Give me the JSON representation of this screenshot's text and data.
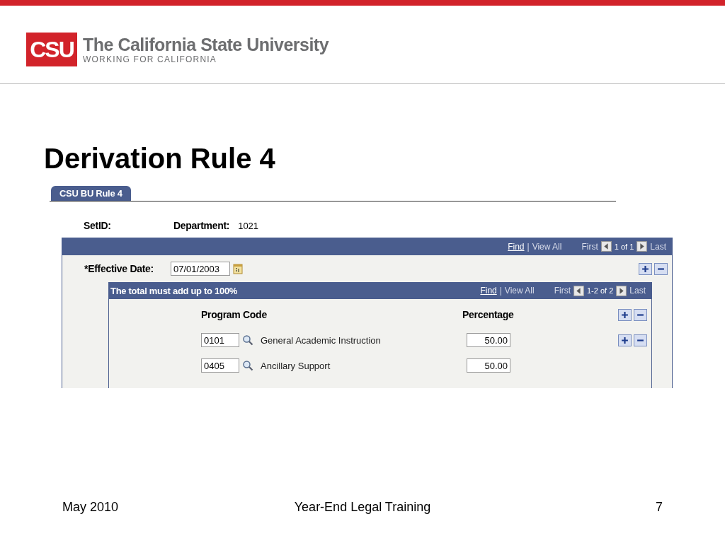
{
  "slide": {
    "logo": {
      "mark": "CSU",
      "name": "The California State University",
      "tagline": "WORKING FOR CALIFORNIA"
    },
    "title": "Derivation Rule 4",
    "footer": {
      "date": "May 2010",
      "center": "Year-End Legal Training",
      "page": "7"
    }
  },
  "tabs": [
    {
      "label": "CSU BU Rule 4",
      "selected": true
    }
  ],
  "keys": {
    "setid_label": "SetID:",
    "department_label": "Department:",
    "department_value": "1021"
  },
  "outer_grid": {
    "nav": {
      "find": "Find",
      "separator": "|",
      "view_all": "View All",
      "first": "First",
      "range": "1 of 1",
      "last": "Last"
    },
    "effective_date_label": "*Effective Date:",
    "effective_date": "07/01/2003"
  },
  "inner_grid": {
    "title": "The total must add up to 100%",
    "nav": {
      "find": "Find",
      "separator": "|",
      "view_all": "View All",
      "first": "First",
      "range": "1-2 of 2",
      "last": "Last"
    },
    "columns": [
      "Program Code",
      "Percentage"
    ],
    "rows": [
      {
        "code": "0101",
        "description": "General Academic Instruction",
        "percentage": "50.00",
        "row_buttons": true
      },
      {
        "code": "0405",
        "description": "Ancillary Support",
        "percentage": "50.00",
        "row_buttons": false
      }
    ]
  }
}
